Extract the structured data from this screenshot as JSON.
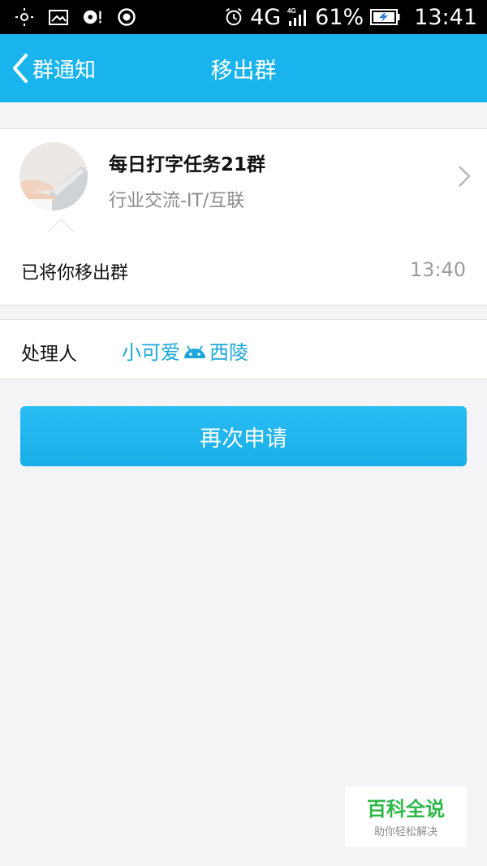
{
  "status_bar": {
    "network": "4G",
    "network_small": "4G",
    "battery_percent": "61%",
    "time": "13:41",
    "icons_left": [
      "brightness-icon",
      "photo-icon",
      "disc-icon",
      "record-icon"
    ],
    "icons_right": [
      "alarm-icon",
      "signal-icon",
      "battery-charging-icon"
    ]
  },
  "header": {
    "back_label": "群通知",
    "title": "移出群"
  },
  "group": {
    "name": "每日打字任务21群",
    "category": "行业交流-IT/互联"
  },
  "message": {
    "text": "已将你移出群",
    "time": "13:40"
  },
  "handler": {
    "label": "处理人",
    "name_part1": "小可爱",
    "name_part2": "西陵"
  },
  "actions": {
    "reapply_label": "再次申请"
  },
  "watermark": {
    "title": "百科全说",
    "subtitle": "助你轻松解决"
  },
  "colors": {
    "accent": "#19b4ee",
    "link": "#1ba7d9",
    "watermark_green": "#2fb84a"
  }
}
